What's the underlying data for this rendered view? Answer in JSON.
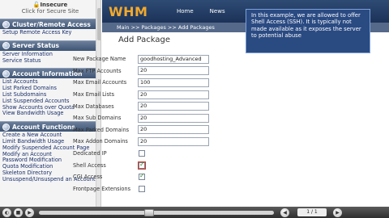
{
  "sidebar": {
    "insecure_title": "Insecure",
    "insecure_sub": "Click for Secure Site",
    "sections": [
      {
        "title": "Cluster/Remote Access",
        "items": [
          "Setup Remote Access Key"
        ]
      },
      {
        "title": "Server Status",
        "items": [
          "Server Information",
          "Service Status"
        ]
      },
      {
        "title": "Account Information",
        "items": [
          "List Accounts",
          "List Parked Domains",
          "List Subdomains",
          "List Suspended Accounts",
          "Show Accounts over Quota",
          "View Bandwidth Usage"
        ]
      },
      {
        "title": "Account Functions",
        "items": [
          "Create a New Account",
          "Limit Bandwidth Usage",
          "Modify Suspended Account Page",
          "Modify an Account",
          "Password Modification",
          "Quota Modification",
          "Skeleton Directory",
          "Unsuspend/Unsuspend an Account"
        ]
      }
    ]
  },
  "header": {
    "logo": "WHM",
    "nav": [
      "Home",
      "News"
    ]
  },
  "breadcrumb": "Main >> Packages >> Add Packages",
  "page_title": "Add Package",
  "form": {
    "rows": [
      {
        "label": "New Package Name",
        "type": "text",
        "value": "goodhosting_Advanced"
      },
      {
        "label": "Max FTP Accounts",
        "type": "text",
        "value": "20"
      },
      {
        "label": "Max Email Accounts",
        "type": "text",
        "value": "100"
      },
      {
        "label": "Max Email Lists",
        "type": "text",
        "value": "20"
      },
      {
        "label": "Max Databases",
        "type": "text",
        "value": "20"
      },
      {
        "label": "Max Sub Domains",
        "type": "text",
        "value": "20"
      },
      {
        "label": "Max Parked Domains",
        "type": "text",
        "value": "20"
      },
      {
        "label": "Max Addon Domains",
        "type": "text",
        "value": "20"
      },
      {
        "label": "Dedicated IP",
        "type": "checkbox",
        "checked": false
      },
      {
        "label": "Shell Access",
        "type": "checkbox",
        "checked": true
      },
      {
        "label": "CGI Access",
        "type": "checkbox",
        "checked": true
      },
      {
        "label": "Frontpage Extensions",
        "type": "checkbox",
        "checked": false
      }
    ]
  },
  "callout": {
    "text": "In this example, we are allowed to offer Shell Access (SSH). It is typically not made available as it exposes the server to potential abuse",
    "close": "x"
  },
  "player": {
    "counter": "1 / 1"
  },
  "icons": [
    "lock-icon",
    "section-icon",
    "play-icon",
    "stop-icon",
    "rewind-icon",
    "forward-icon",
    "volume-icon"
  ]
}
